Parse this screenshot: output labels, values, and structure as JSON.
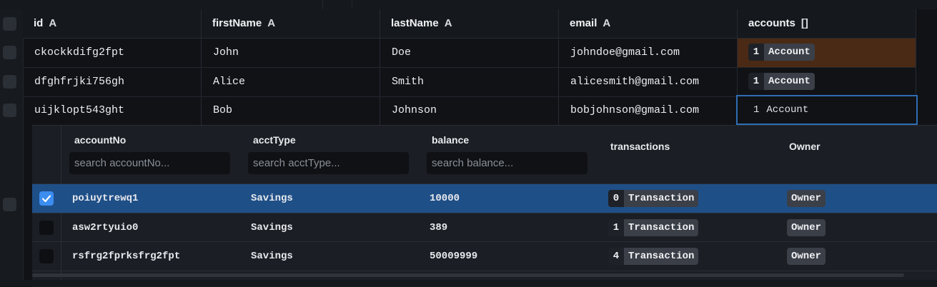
{
  "table": {
    "columns": [
      {
        "name": "id",
        "type": "A"
      },
      {
        "name": "firstName",
        "type": "A"
      },
      {
        "name": "lastName",
        "type": "A"
      },
      {
        "name": "email",
        "type": "A"
      },
      {
        "name": "accounts",
        "type": "[]"
      }
    ],
    "rows": [
      {
        "id": "ckockkdifg2fpt",
        "firstName": "John",
        "lastName": "Doe",
        "email": "johndoe@gmail.com",
        "accounts_count": "1",
        "accounts_label": "Account"
      },
      {
        "id": "dfghfrjki756gh",
        "firstName": "Alice",
        "lastName": "Smith",
        "email": "alicesmith@gmail.com",
        "accounts_count": "1",
        "accounts_label": "Account"
      },
      {
        "id": "uijklopt543ght",
        "firstName": "Bob",
        "lastName": "Johnson",
        "email": "bobjohnson@gmail.com",
        "accounts_count": "1",
        "accounts_label": "Account"
      }
    ]
  },
  "nested": {
    "columns": [
      {
        "name": "accountNo",
        "placeholder": "search accountNo..."
      },
      {
        "name": "acctType",
        "placeholder": "search acctType..."
      },
      {
        "name": "balance",
        "placeholder": "search balance..."
      },
      {
        "name": "transactions"
      },
      {
        "name": "Owner"
      }
    ],
    "rows": [
      {
        "accountNo": "poiuytrewq1",
        "acctType": "Savings",
        "balance": "10000",
        "tx_count": "0",
        "tx_label": "Transaction",
        "owner": "Owner",
        "checked": true
      },
      {
        "accountNo": "asw2rtyuio0",
        "acctType": "Savings",
        "balance": "389",
        "tx_count": "1",
        "tx_label": "Transaction",
        "owner": "Owner",
        "checked": false
      },
      {
        "accountNo": "rsfrg2fprksfrg2fpt",
        "acctType": "Savings",
        "balance": "50009999",
        "tx_count": "4",
        "tx_label": "Transaction",
        "owner": "Owner",
        "checked": false
      }
    ]
  },
  "colors": {
    "selection_blue": "#1f4f87",
    "checkbox_blue": "#3b8df0",
    "highlight_orange": "#4a2a14",
    "focus_border": "#2f6db3"
  }
}
